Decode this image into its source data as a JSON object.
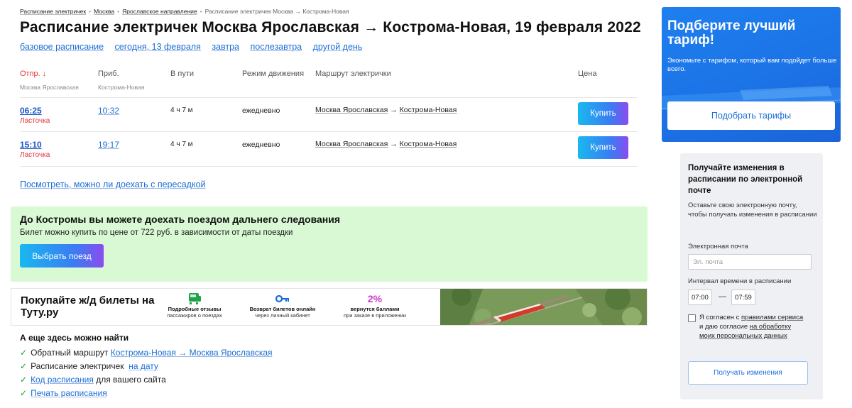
{
  "breadcrumb": {
    "items": [
      "Расписание электричек",
      "Москва",
      "Ярославское направление"
    ],
    "separator": "•",
    "current": "Расписание электричек Москва → Кострома-Новая"
  },
  "page_title": "Расписание электричек Москва Ярославская → Кострома-Новая, 19 февраля 2022",
  "day_links": [
    "базовое расписание",
    "сегодня, 13 февраля",
    "завтра",
    "послезавтра",
    "другой день"
  ],
  "table": {
    "headers": {
      "departure": "Отпр. ↓",
      "departure_station": "Москва Ярославская",
      "arrival": "Приб.",
      "arrival_station": "Кострома-Новая",
      "duration": "В пути",
      "mode": "Режим движения",
      "route": "Маршрут электрички",
      "price": "Цена"
    },
    "rows": [
      {
        "dep": "06:25",
        "train": "Ласточка",
        "arr": "10:32",
        "duration": "4 ч 7 м",
        "mode": "ежедневно",
        "from": "Москва Ярославская",
        "arrow": "→",
        "to": "Кострома-Новая",
        "buy": "Купить"
      },
      {
        "dep": "15:10",
        "train": "Ласточка",
        "arr": "19:17",
        "duration": "4 ч 7 м",
        "mode": "ежедневно",
        "from": "Москва Ярославская",
        "arrow": "→",
        "to": "Кострома-Новая",
        "buy": "Купить"
      }
    ]
  },
  "transfer_link": "Посмотреть, можно ли доехать с пересадкой",
  "long_distance": {
    "title": "До Костромы вы можете доехать поездом дальнего следования",
    "text": "Билет можно купить по цене от 722 руб. в зависимости от даты поездки",
    "button": "Выбрать поезд"
  },
  "banner": {
    "title": "Покупайте ж/д билеты на Туту.ру",
    "features": [
      {
        "title": "Подробные отзывы",
        "text": "пассажиров о поездах",
        "icon": "train-icon"
      },
      {
        "title": "Возврат билетов онлайн",
        "text": "через личный кабинет",
        "icon": "key-icon"
      },
      {
        "title": "вернутся баллами",
        "text": "при заказе в приложении",
        "highlight": "2%"
      }
    ]
  },
  "also": {
    "title": "А еще здесь можно найти",
    "items": [
      {
        "prefix": "Обратный маршрут",
        "link": "Кострома-Новая → Москва Ярославская",
        "suffix": ""
      },
      {
        "prefix": "Расписание электричек",
        "link": "на дату",
        "suffix": ""
      },
      {
        "prefix": "",
        "link": "Код расписания",
        "suffix": "для вашего сайта"
      },
      {
        "prefix": "",
        "link": "Печать расписания",
        "suffix": ""
      }
    ]
  },
  "tariff": {
    "title": "Подберите лучший тариф!",
    "text": "Экономьте с тарифом, который вам подойдет больше всего.",
    "button": "Подобрать тарифы"
  },
  "subscribe": {
    "title": "Получайте изменения в расписании по электронной почте",
    "text": "Оставьте свою электронную почту, чтобы получать изменения в расписании",
    "email_label": "Электронная почта",
    "email_placeholder": "Эл. почта",
    "interval_label": "Интервал времени в расписании",
    "time_from": "07:00",
    "time_dash": "—",
    "time_to": "07:59",
    "consent_prefix": "Я согласен с",
    "consent_link1": "правилами сервиса",
    "consent_middle": "и даю согласие",
    "consent_link2": "на обработку моих персональных данных",
    "button": "Получать изменения"
  },
  "colors": {
    "link": "#1a6dd6",
    "accent_red": "#e5333d",
    "green_bg": "#d9f8d4",
    "tariff_bg": "#1e7fee",
    "check_green": "#1e9c3a"
  }
}
